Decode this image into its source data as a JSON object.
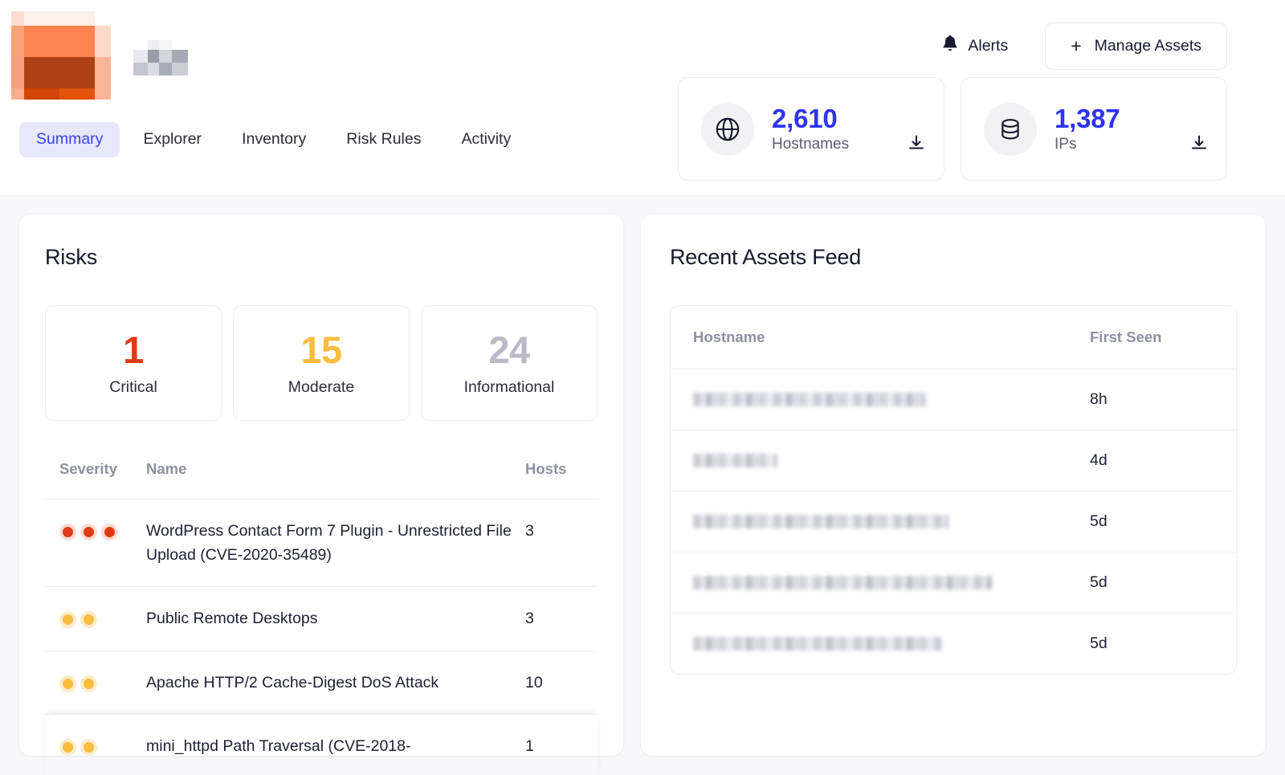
{
  "brand": {
    "logo_name": "redacted-company-logo",
    "wordmark_name": "redacted-company-wordmark"
  },
  "header": {
    "tabs": [
      {
        "label": "Summary",
        "active": true
      },
      {
        "label": "Explorer",
        "active": false
      },
      {
        "label": "Inventory",
        "active": false
      },
      {
        "label": "Risk Rules",
        "active": false
      },
      {
        "label": "Activity",
        "active": false
      }
    ],
    "alerts_label": "Alerts",
    "alerts_icon": "bell-icon",
    "manage_assets_label": "Manage Assets",
    "manage_assets_icon": "plus-icon",
    "stat_cards": [
      {
        "icon": "globe-icon",
        "value": "2,610",
        "label": "Hostnames",
        "download_icon": "download-icon"
      },
      {
        "icon": "database-icon",
        "value": "1,387",
        "label": "IPs",
        "download_icon": "download-icon"
      }
    ]
  },
  "risks": {
    "title": "Risks",
    "severity_cards": [
      {
        "count": "1",
        "label": "Critical",
        "color": "#e03b16"
      },
      {
        "count": "15",
        "label": "Moderate",
        "color": "#fbbc3f"
      },
      {
        "count": "24",
        "label": "Informational",
        "color": "#b9bac6"
      }
    ],
    "columns": {
      "severity": "Severity",
      "name": "Name",
      "hosts": "Hosts"
    },
    "rows": [
      {
        "severity_level": "critical",
        "severity_dots": 3,
        "name": "WordPress Contact Form 7 Plugin - Unrestricted File Upload (CVE-2020-35489)",
        "hosts": "3"
      },
      {
        "severity_level": "moderate",
        "severity_dots": 2,
        "name": "Public Remote Desktops",
        "hosts": "3"
      },
      {
        "severity_level": "moderate",
        "severity_dots": 2,
        "name": "Apache HTTP/2 Cache-Digest DoS Attack",
        "hosts": "10"
      },
      {
        "severity_level": "moderate",
        "severity_dots": 2,
        "name": "mini_httpd Path Traversal (CVE-2018-",
        "hosts": "1"
      }
    ]
  },
  "recent_assets_feed": {
    "title": "Recent Assets Feed",
    "columns": {
      "hostname": "Hostname",
      "first_seen": "First Seen"
    },
    "rows": [
      {
        "hostname": "",
        "hostname_redacted": true,
        "redact_width": 290,
        "first_seen": "8h"
      },
      {
        "hostname": "",
        "hostname_redacted": true,
        "redact_width": 105,
        "first_seen": "4d"
      },
      {
        "hostname": "",
        "hostname_redacted": true,
        "redact_width": 318,
        "first_seen": "5d"
      },
      {
        "hostname": "",
        "hostname_redacted": true,
        "redact_width": 372,
        "first_seen": "5d"
      },
      {
        "hostname": "",
        "hostname_redacted": true,
        "redact_width": 310,
        "first_seen": "5d"
      }
    ]
  },
  "theme": {
    "accent_blue": "#2f33f2",
    "tab_active_bg": "#e7e8fb",
    "tab_active_fg": "#3b3ef0",
    "page_bg": "#f8f8fa",
    "panel_bg": "#ffffff",
    "text_primary": "#15172b",
    "text_muted": "#8e90a0"
  }
}
